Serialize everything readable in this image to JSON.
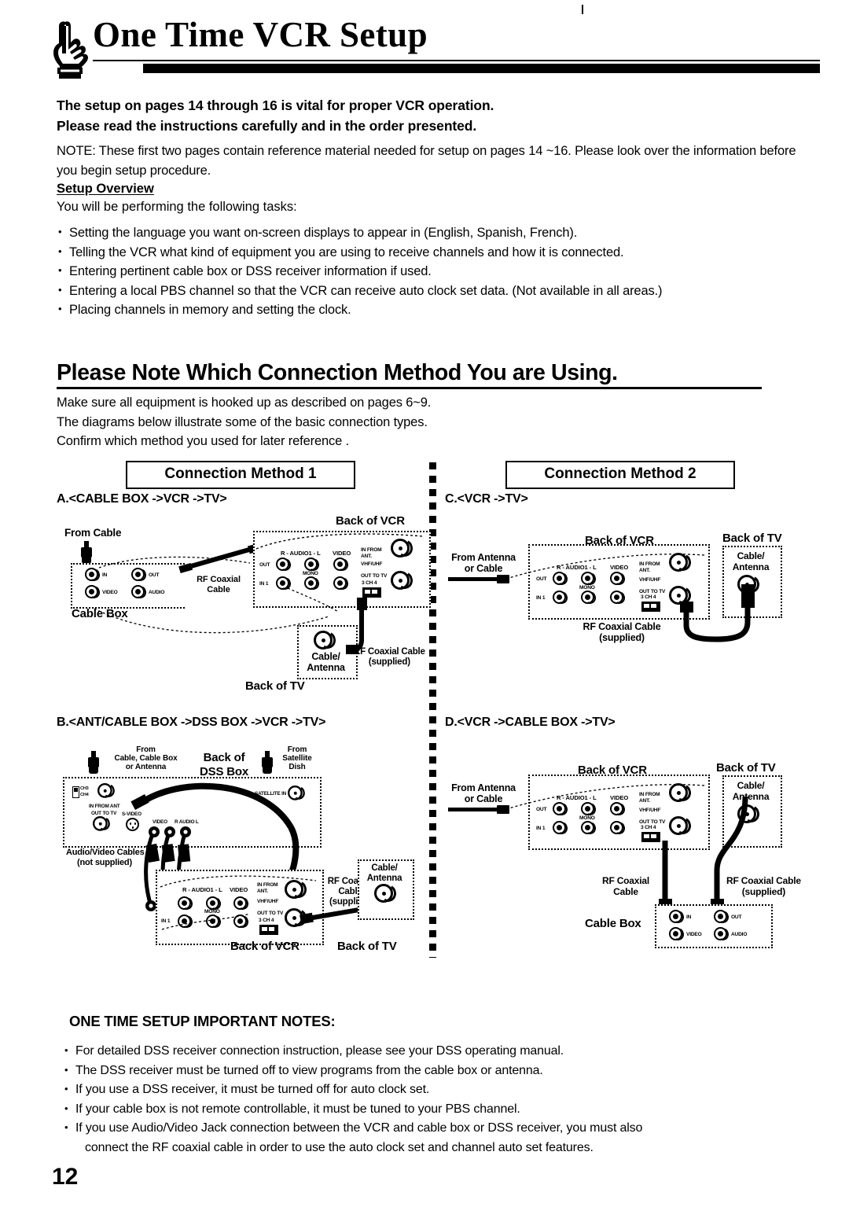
{
  "header": {
    "icon": "pointing-hand-icon",
    "title": "One Time VCR Setup"
  },
  "intro": {
    "bold_line_1": "The setup on pages 14 through 16 is vital for proper VCR operation.",
    "bold_line_2": "Please read the instructions carefully and in the order presented.",
    "note": "NOTE: These first two pages contain reference material needed for setup on pages 14 ~16. Please look over the information  before you begin setup procedure.",
    "overview_heading": "Setup Overview",
    "overview_lead": "You will be performing the following tasks:",
    "tasks": [
      "Setting the  language you want on-screen displays to appear in (English, Spanish, French).",
      "Telling the VCR what kind of equipment you are using to receive channels and how it is connected.",
      "Entering pertinent cable box or DSS receiver information if used.",
      "Entering  a local PBS channel so that the VCR can receive auto clock set data. (Not available in all areas.)",
      "Placing channels in memory and setting the clock."
    ]
  },
  "connection_section": {
    "heading": "Please Note Which Connection Method You are Using.",
    "lines": [
      "Make sure all equipment is hooked up as described on pages 6~9.",
      "The diagrams below illustrate some of the basic connection types.",
      "Confirm which method you used for later reference ."
    ],
    "method_1_label": "Connection Method 1",
    "method_2_label": "Connection Method 2"
  },
  "diagrams": {
    "a": {
      "title": "A.<CABLE BOX ->VCR ->TV>",
      "from_cable": "From Cable",
      "cable_box_label": "Cable Box",
      "cable_box_jacks": [
        "IN",
        "OUT",
        "VIDEO",
        "AUDIO"
      ],
      "rf_cable": "RF Coaxial\nCable",
      "rf_cable_l1": "RF Coaxial",
      "rf_cable_l2": "Cable",
      "back_of_vcr": "Back of VCR",
      "vcr_labels": {
        "audio": "R - AUDIO1 - L",
        "video": "VIDEO",
        "in_from_ant": "IN FROM\nANT.",
        "in_from_ant_l1": "IN FROM",
        "in_from_ant_l2": "ANT.",
        "out": "OUT",
        "mono": "MONO",
        "in1": "IN 1",
        "vhf_uhf": "VHF/UHF",
        "out_to_tv": "OUT TO TV",
        "ch_switch": "3 CH 4"
      },
      "back_of_tv": "Back of TV",
      "tv_jack_l1": "Cable/",
      "tv_jack_l2": "Antenna",
      "supplied_cable_l1": "RF Coaxial Cable",
      "supplied_cable_l2": "(supplied)"
    },
    "b": {
      "title": "B.<ANT/CABLE BOX ->DSS BOX ->VCR ->TV>",
      "from_cable_l1": "From",
      "from_cable_l2": "Cable, Cable Box",
      "from_cable_l3": "or Antenna",
      "back_of_dss_l1": "Back of",
      "back_of_dss_l2": "DSS Box",
      "from_dish_l1": "From",
      "from_dish_l2": "Satellite",
      "from_dish_l3": "Dish",
      "dss_labels": {
        "ch3": "CH3",
        "ch4": "CH4",
        "in_from_ant": "IN FROM ANT",
        "out_to_tv": "OUT TO TV",
        "s_video": "S-VIDEO",
        "video": "VIDEO",
        "audio": "R  AUDIO  L",
        "satellite_in": "SATELLITE IN"
      },
      "av_cables_l1": "Audio/Video Cables",
      "av_cables_l2": "(not supplied)",
      "back_of_vcr": "Back of VCR",
      "vcr_labels": {
        "audio": "R - AUDIO1 - L",
        "video": "VIDEO",
        "in_from_ant_l1": "IN FROM",
        "in_from_ant_l2": "ANT.",
        "out": "OUT",
        "mono": "MONO",
        "in1": "IN 1",
        "vhf_uhf": "VHF/UHF",
        "out_to_tv": "OUT TO TV",
        "ch_switch": "3 CH 4"
      },
      "rf_cable_l1": "RF Coaxial",
      "rf_cable_l2": "Cable",
      "rf_cable_l3": "(supplied)",
      "back_of_tv": "Back of TV",
      "tv_jack_l1": "Cable/",
      "tv_jack_l2": "Antenna"
    },
    "c": {
      "title": "C.<VCR ->TV>",
      "from_antenna_l1": "From Antenna",
      "from_antenna_l2": "or Cable",
      "back_of_vcr": "Back of VCR",
      "vcr_labels": {
        "audio": "R - AUDIO1 - L",
        "video": "VIDEO",
        "in_from_ant_l1": "IN FROM",
        "in_from_ant_l2": "ANT.",
        "out": "OUT",
        "mono": "MONO",
        "in1": "IN 1",
        "vhf_uhf": "VHF/UHF",
        "out_to_tv": "OUT TO TV",
        "ch_switch": "3 CH 4"
      },
      "back_of_tv": "Back of TV",
      "tv_jack_l1": "Cable/",
      "tv_jack_l2": "Antenna",
      "rf_cable_l1": "RF Coaxial Cable",
      "rf_cable_l2": "(supplied)"
    },
    "d": {
      "title": "D.<VCR ->CABLE BOX ->TV>",
      "from_antenna_l1": "From Antenna",
      "from_antenna_l2": "or Cable",
      "back_of_vcr": "Back of VCR",
      "vcr_labels": {
        "audio": "R - AUDIO1 - L",
        "video": "VIDEO",
        "in_from_ant_l1": "IN FROM",
        "in_from_ant_l2": "ANT.",
        "out": "OUT",
        "mono": "MONO",
        "in1": "IN 1",
        "vhf_uhf": "VHF/UHF",
        "out_to_tv": "OUT TO TV",
        "ch_switch": "3 CH 4"
      },
      "back_of_tv": "Back of TV",
      "tv_jack_l1": "Cable/",
      "tv_jack_l2": "Antenna",
      "rf_cable_l1": "RF Coaxial",
      "rf_cable_l2": "Cable",
      "supplied_cable_l1": "RF Coaxial Cable",
      "supplied_cable_l2": "(supplied)",
      "cable_box_label": "Cable Box",
      "cable_box_jacks": [
        "IN",
        "OUT",
        "VIDEO",
        "AUDIO"
      ]
    }
  },
  "notes": {
    "heading": "ONE TIME SETUP IMPORTANT NOTES:",
    "items": [
      "For detailed DSS receiver connection instruction, please see your DSS operating manual.",
      "The DSS receiver must be turned off to view programs from the cable box or antenna.",
      "If you use a DSS receiver, it must be turned off for auto clock set.",
      "If your cable box is not remote controllable, it must be tuned to your PBS channel."
    ],
    "last_item_line_1": "If you use Audio/Video Jack connection between the VCR and cable box or DSS receiver, you must also",
    "last_item_line_2": "connect the RF coaxial cable in order to use the auto clock set and channel auto set features."
  },
  "footer": {
    "page_number": "12"
  }
}
